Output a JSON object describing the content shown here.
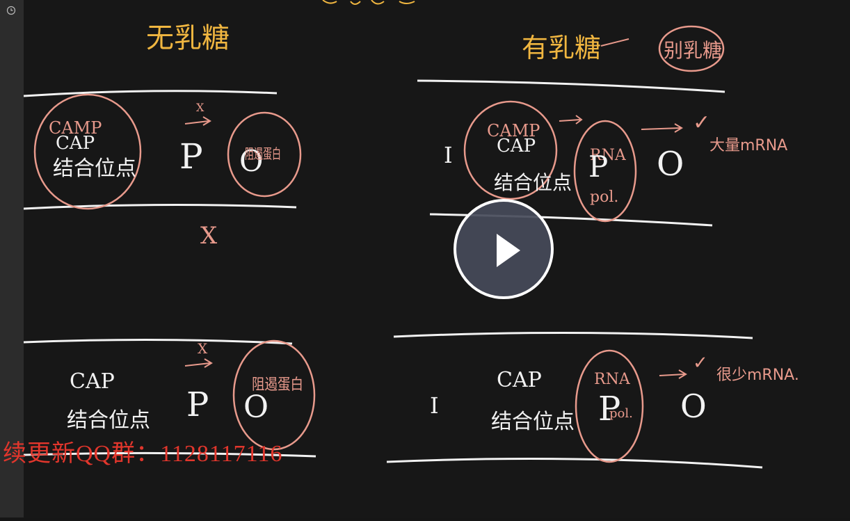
{
  "sidebar": {
    "icon": "clock-icon"
  },
  "board": {
    "top_left_heading": "无乳糖",
    "top_right_heading": "有乳糖",
    "top_right_heading2": "别乳糖",
    "cap": "CAP",
    "camp": "CAMP",
    "binding_site": "结合位点",
    "promoter": "P",
    "operator": "O",
    "x_mark": "X",
    "check_mark": "✓",
    "inhibitor_protein": "阻遏蛋白",
    "rna": "RNA",
    "pol": "pol.",
    "gene_i": "I",
    "large_mrna": "大量mRNA",
    "little_mrna": "很少mRNA."
  },
  "watermark": {
    "text": "续更新QQ群：1128117116"
  },
  "player": {
    "play_icon": "play-icon"
  },
  "colors": {
    "chalk_white": "#f2f2f2",
    "chalk_pink": "#e89a8c",
    "chalk_yellow": "#f0b640",
    "watermark_red": "#e2362c"
  }
}
